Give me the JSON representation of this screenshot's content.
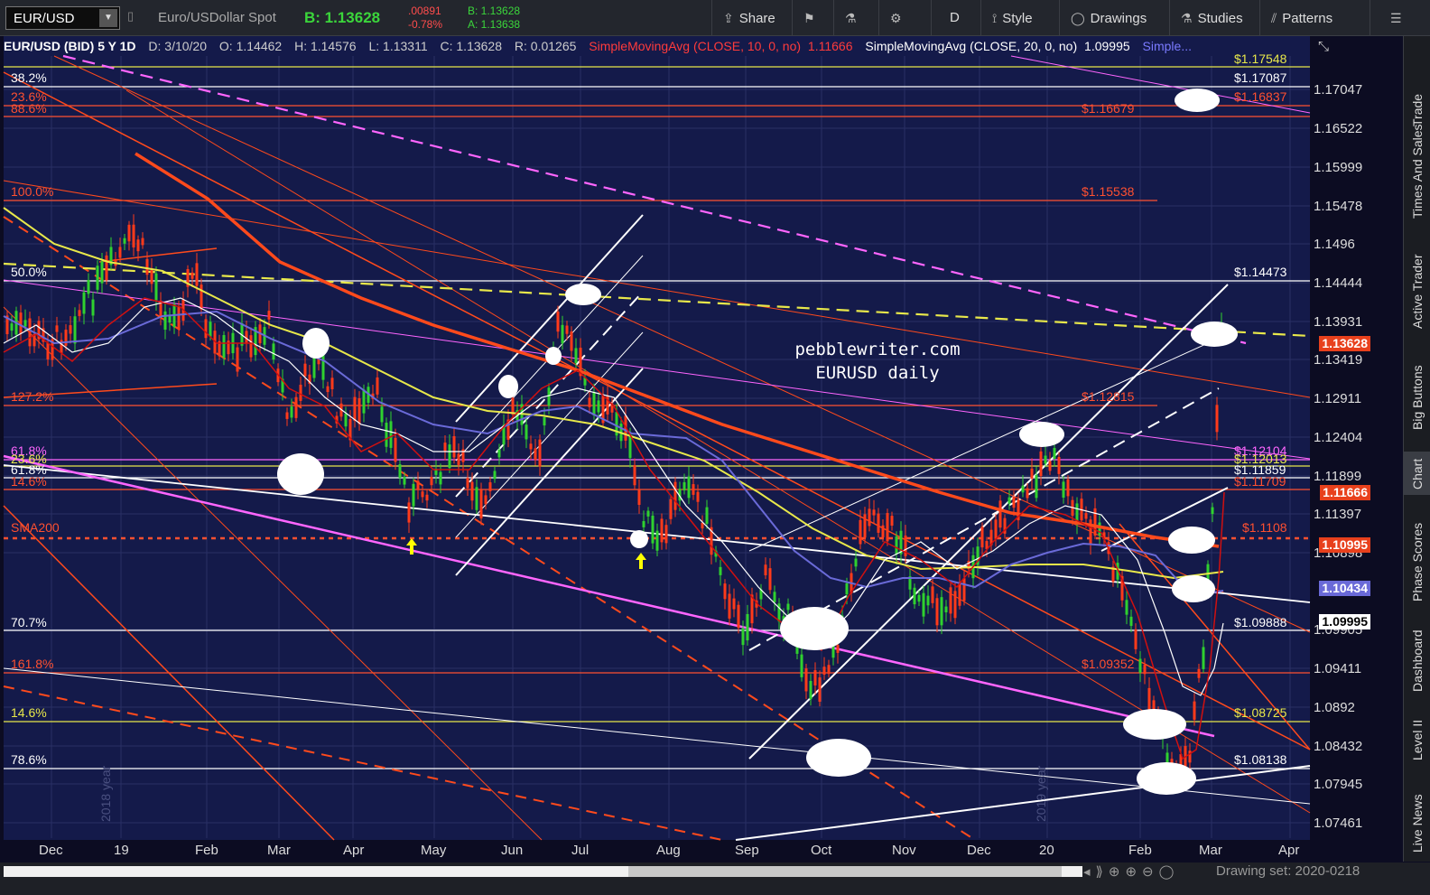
{
  "toolbar": {
    "symbol": "EUR/USD",
    "description": "Euro/USDollar Spot",
    "bid_text": "B: 1.13628",
    "change": ".00891",
    "change_pct": "-0.78%",
    "bid_small": "B: 1.13628",
    "ask_small": "A: 1.13638",
    "buttons": [
      {
        "label": "Share",
        "icon": "share-icon"
      },
      {
        "label": "",
        "icon": "flag-icon"
      },
      {
        "label": "",
        "icon": "flask-icon"
      },
      {
        "label": "",
        "icon": "gear-icon"
      },
      {
        "label": "D",
        "icon": ""
      },
      {
        "label": "Style",
        "icon": "style-icon"
      },
      {
        "label": "Drawings",
        "icon": "drawings-icon"
      },
      {
        "label": "Studies",
        "icon": "flask-icon"
      },
      {
        "label": "Patterns",
        "icon": "patterns-icon"
      }
    ]
  },
  "legend": {
    "title": "EUR/USD (BID) 5 Y 1D",
    "date": "D: 3/10/20",
    "open": "O: 1.14462",
    "high": "H: 1.14576",
    "low": "L: 1.13311",
    "close": "C: 1.13628",
    "range": "R: 0.01265",
    "sma10": "SimpleMovingAvg (CLOSE, 10, 0, no)",
    "sma10_val": "1.11666",
    "sma20": "SimpleMovingAvg (CLOSE, 20, 0, no)",
    "sma20_val": "1.09995",
    "more": "Simple..."
  },
  "sidebar": [
    "Trade",
    "Times And Sales",
    "Active Trader",
    "Big Buttons",
    "Chart",
    "Phase Scores",
    "Dashboard",
    "Level II",
    "Live News"
  ],
  "bottom": {
    "drawing_set": "Drawing set: 2020-0218"
  },
  "chart_data": {
    "type": "candlestick",
    "title": "pebblewriter.com",
    "subtitle": "EURUSD daily",
    "x_labels": [
      "Dec",
      "19",
      "Feb",
      "Mar",
      "Apr",
      "May",
      "Jun",
      "Jul",
      "Aug",
      "Sep",
      "Oct",
      "Nov",
      "Dec",
      "20",
      "Feb",
      "Mar",
      "Apr"
    ],
    "year_labels": [
      "2018 year",
      "2019 year"
    ],
    "y_ticks": [
      "1.17047",
      "1.16522",
      "1.15999",
      "1.15478",
      "1.1496",
      "1.14444",
      "1.13931",
      "1.13419",
      "1.12911",
      "1.12404",
      "1.11899",
      "1.11397",
      "1.10898",
      "1.09905",
      "1.09411",
      "1.0892",
      "1.08432",
      "1.07945",
      "1.07461"
    ],
    "price_tags": [
      {
        "label": "1.13628",
        "color": "#e8401c"
      },
      {
        "label": "1.11666",
        "color": "#e8401c"
      },
      {
        "label": "1.10995",
        "color": "#e8401c"
      },
      {
        "label": "1.10434",
        "color": "#6a6ad8"
      },
      {
        "label": "1.09995",
        "color": "#ffffff"
      }
    ],
    "fib_left": [
      {
        "label": "38.2%",
        "color": "#ffffff"
      },
      {
        "label": "23.6%",
        "color": "#ff5030"
      },
      {
        "label": "88.6%",
        "color": "#ff5030"
      },
      {
        "label": "100.0%",
        "color": "#ff5030"
      },
      {
        "label": "50.0%",
        "color": "#ffffff"
      },
      {
        "label": "127.2%",
        "color": "#ff5030"
      },
      {
        "label": "61.8%",
        "color": "#ff66ff"
      },
      {
        "label": "23.6%",
        "color": "#e8e84a"
      },
      {
        "label": "61.8%",
        "color": "#ffffff"
      },
      {
        "label": "14.6%",
        "color": "#ff5030"
      },
      {
        "label": "SMA200",
        "color": "#ff5030"
      },
      {
        "label": "70.7%",
        "color": "#ffffff"
      },
      {
        "label": "161.8%",
        "color": "#ff5030"
      },
      {
        "label": "14.6%",
        "color": "#e8e84a"
      },
      {
        "label": "78.6%",
        "color": "#ffffff"
      }
    ],
    "fib_right": [
      {
        "label": "$1.17548",
        "color": "#e8e84a"
      },
      {
        "label": "$1.17087",
        "color": "#ffffff"
      },
      {
        "label": "$1.16837",
        "color": "#ff5030"
      },
      {
        "label": "$1.16679",
        "color": "#ff5030"
      },
      {
        "label": "$1.15538",
        "color": "#ff5030"
      },
      {
        "label": "$1.14473",
        "color": "#ffffff"
      },
      {
        "label": "$1.12815",
        "color": "#ff5030"
      },
      {
        "label": "$1.12104",
        "color": "#ff66ff"
      },
      {
        "label": "$1.12013",
        "color": "#e8e84a"
      },
      {
        "label": "$1.11859",
        "color": "#ffffff"
      },
      {
        "label": "$1.11709",
        "color": "#ff5030"
      },
      {
        "label": "$1.1108",
        "color": "#ff5030"
      },
      {
        "label": "$1.09888",
        "color": "#ffffff"
      },
      {
        "label": "$1.09352",
        "color": "#ff5030"
      },
      {
        "label": "$1.08725",
        "color": "#e8e84a"
      },
      {
        "label": "$1.08138",
        "color": "#ffffff"
      }
    ]
  }
}
